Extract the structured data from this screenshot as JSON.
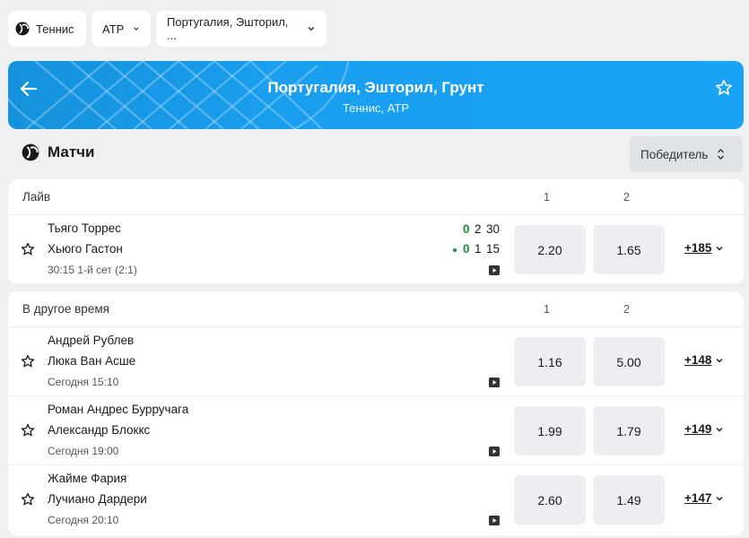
{
  "filters": {
    "sport": "Теннис",
    "tour": "ATP",
    "tournament": "Португалия, Эшторил, ..."
  },
  "banner": {
    "title": "Португалия, Эшторил, Грунт",
    "subtitle": "Теннис, ATP"
  },
  "matches": {
    "title": "Матчи",
    "market_button": "Победитель"
  },
  "live": {
    "label": "Лайв",
    "col1": "1",
    "col2": "2",
    "match": {
      "player1": "Тьяго Торрес",
      "player2": "Хьюго Гастон",
      "p1_sets": "0",
      "p1_games": "2",
      "p1_points": "30",
      "p2_sets": "0",
      "p2_games": "1",
      "p2_points": "15",
      "status": "30:15 1-й сет (2:1)",
      "odd1": "2.20",
      "odd2": "1.65",
      "more": "+185"
    }
  },
  "other": {
    "label": "В другое время",
    "col1": "1",
    "col2": "2",
    "matches": [
      {
        "player1": "Андрей Рублев",
        "player2": "Люка Ван Асше",
        "time": "Сегодня 15:10",
        "odd1": "1.16",
        "odd2": "5.00",
        "more": "+148"
      },
      {
        "player1": "Роман Андрес Бурручага",
        "player2": "Александр Блоккс",
        "time": "Сегодня 19:00",
        "odd1": "1.99",
        "odd2": "1.79",
        "more": "+149"
      },
      {
        "player1": "Жайме Фария",
        "player2": "Лучиано Дардери",
        "time": "Сегодня 20:10",
        "odd1": "2.60",
        "odd2": "1.49",
        "more": "+147"
      }
    ]
  },
  "icons": {
    "sport": "tennis-ball-icon",
    "back": "arrow-left-icon",
    "favorite": "star-outline-icon",
    "video": "video-play-icon",
    "dropdown": "chevron-down-icon",
    "sort": "sort-updown-icon"
  },
  "colors": {
    "banner": "#1a9ff0",
    "live_score": "#1a8f3c",
    "background": "#eef0f2"
  }
}
